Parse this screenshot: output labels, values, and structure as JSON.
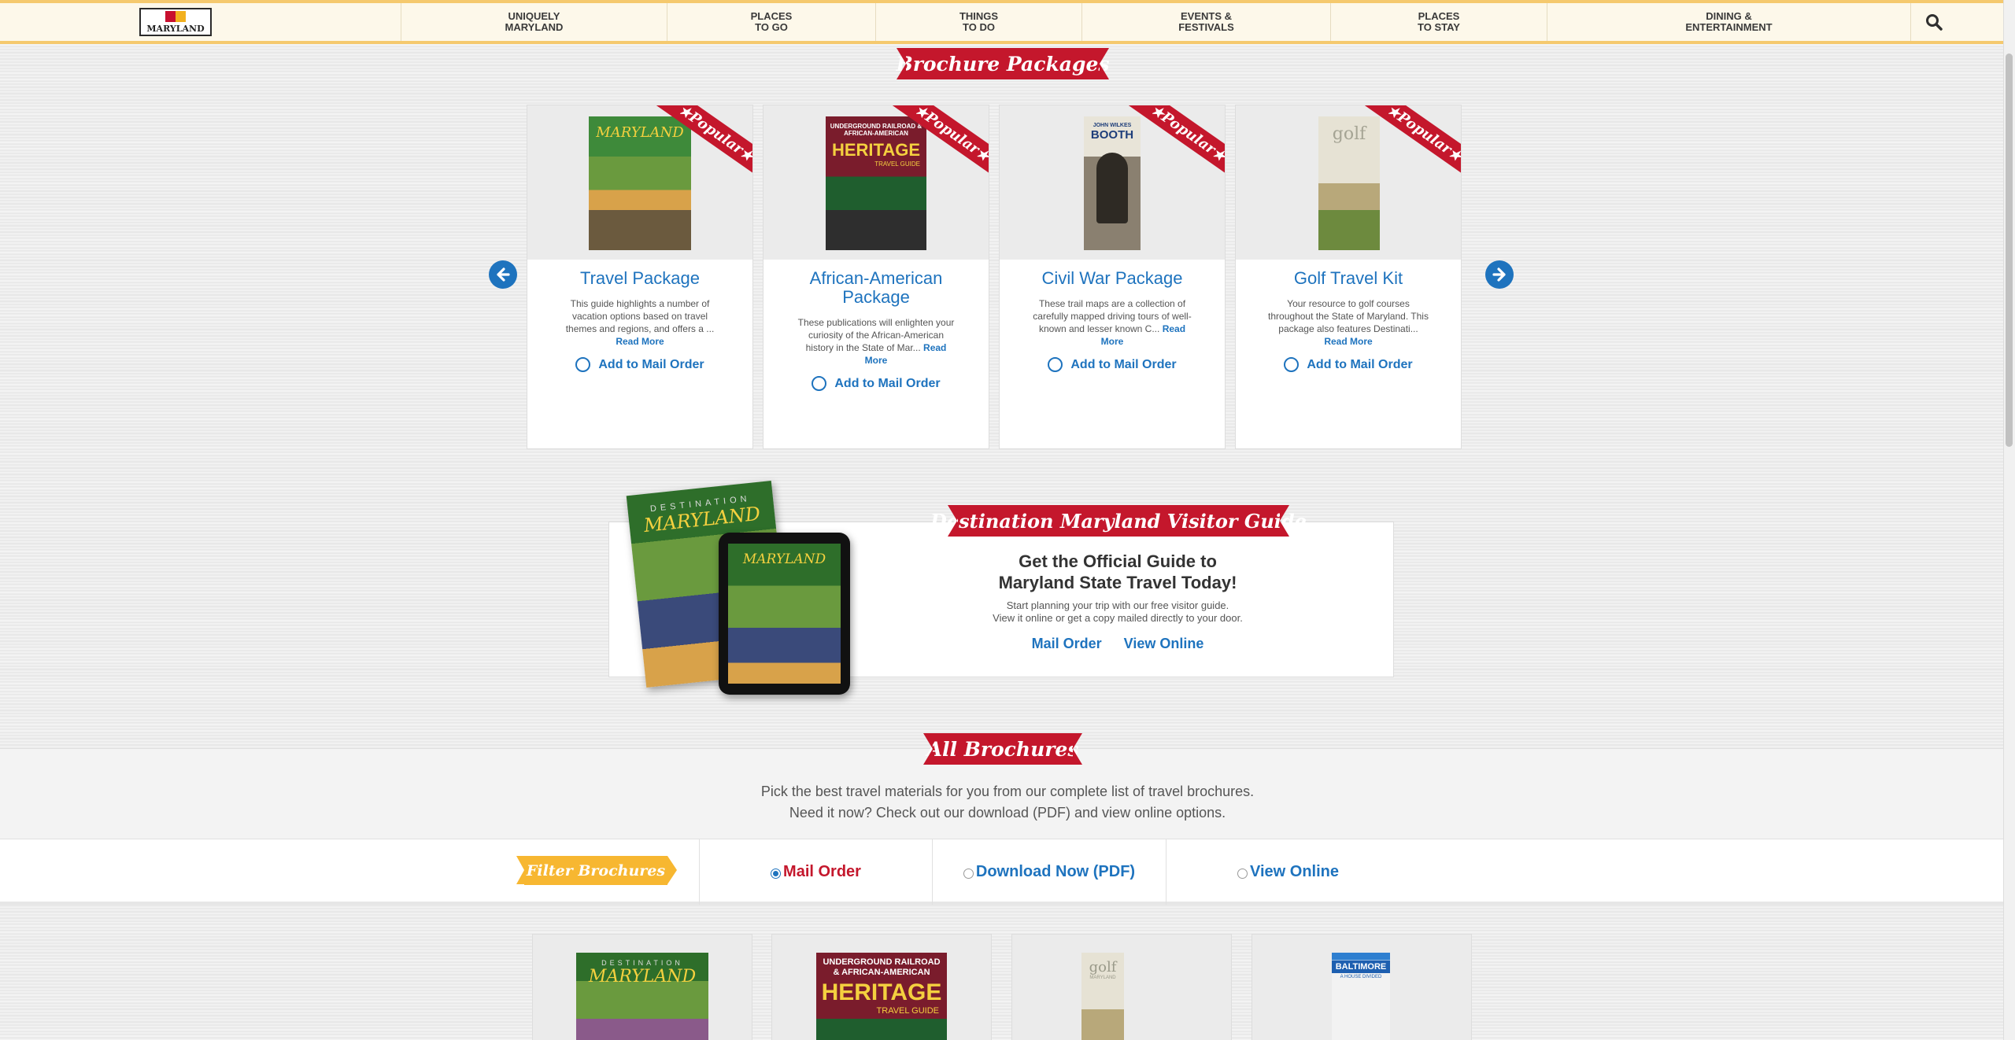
{
  "nav": {
    "logo_text": "MARYLAND",
    "items": [
      {
        "label": "UNIQUELY\nMARYLAND"
      },
      {
        "label": "PLACES\nTO GO"
      },
      {
        "label": "THINGS\nTO DO"
      },
      {
        "label": "EVENTS &\nFESTIVALS"
      },
      {
        "label": "PLACES\nTO STAY"
      },
      {
        "label": "DINING &\nENTERTAINMENT"
      }
    ],
    "search_icon": "search-icon"
  },
  "packages": {
    "title": "Brochure Packages",
    "badge": "Popular",
    "add_label": "Add to Mail Order",
    "read_more": "Read More",
    "cards": [
      {
        "title": "Travel Package",
        "desc": "This guide highlights a number of vacation options based on travel themes and regions, and offers a ...",
        "cover_title": "MARYLAND"
      },
      {
        "title": "African-American Package",
        "desc": "These publications will enlighten your curiosity of the African-American history in the State of Mar...",
        "cover_title": "HERITAGE",
        "cover_sub": "UNDERGROUND RAILROAD & AFRICAN-AMERICAN",
        "cover_tag": "TRAVEL GUIDE"
      },
      {
        "title": "Civil War Package",
        "desc": "These trail maps are a collection of carefully mapped driving tours of well-known and lesser known C...",
        "cover_title": "BOOTH",
        "cover_sub": "JOHN WILKES"
      },
      {
        "title": "Golf Travel Kit",
        "desc": "Your resource to golf courses throughout the State of Maryland. This package also features Destinati...",
        "cover_title": "golf"
      }
    ]
  },
  "guide": {
    "title": "Destination Maryland Visitor Guide",
    "heading_line1": "Get the Official Guide to",
    "heading_line2": "Maryland State Travel Today!",
    "text_line1": "Start planning your trip with our free visitor guide.",
    "text_line2": "View it online or get a copy mailed directly to your door.",
    "mail_order": "Mail Order",
    "view_online": "View Online",
    "cover_title": "MARYLAND",
    "cover_top": "DESTINATION"
  },
  "all": {
    "title": "All Brochures",
    "intro_line1": "Pick the best travel materials for you from our complete list of travel brochures.",
    "intro_line2": "Need it now? Check out our download (PDF) and view online options.",
    "filter_label": "Filter Brochures",
    "filters": [
      "Mail Order",
      "Download Now (PDF)",
      "View Online"
    ],
    "selected_filter": "Mail Order",
    "brochures": [
      {
        "cover_title": "MARYLAND",
        "cover_top": "DESTINATION"
      },
      {
        "cover_title": "HERITAGE",
        "cover_sub": "UNDERGROUND RAILROAD & AFRICAN-AMERICAN",
        "cover_tag": "TRAVEL GUIDE"
      },
      {
        "cover_title": "golf",
        "cover_sub": "MARYLAND"
      },
      {
        "cover_title": "BALTIMORE",
        "cover_sub": "A HOUSE DIVIDED"
      }
    ]
  },
  "colors": {
    "accent": "#1e73be",
    "ribbon": "#c4172c",
    "filter_tag": "#f7b731",
    "nav_bg": "#fdf8ea"
  }
}
